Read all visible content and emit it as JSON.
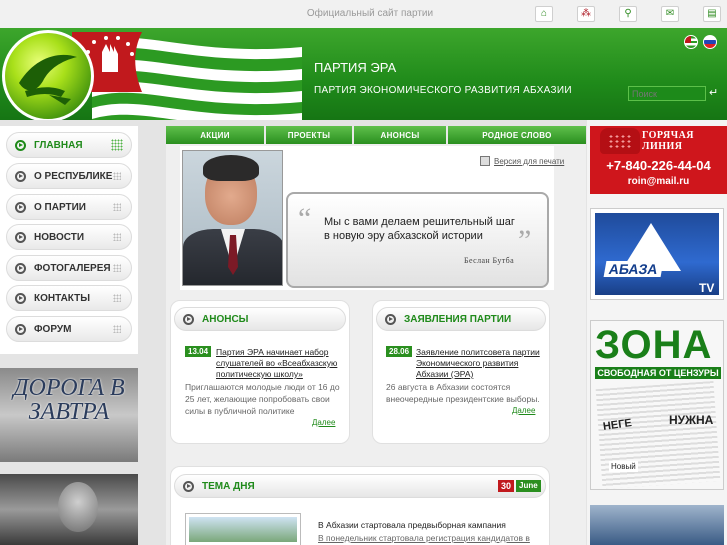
{
  "top": {
    "site_label": "Официальный сайт партии",
    "icons": [
      "home-icon",
      "sitemap-icon",
      "search-icon",
      "mail-icon",
      "print-icon"
    ]
  },
  "header": {
    "title": "ПАРТИЯ ЭРА",
    "subtitle": "ПАРТИЯ ЭКОНОМИЧЕСКОГО РАЗВИТИЯ АБХАЗИИ",
    "search_placeholder": "Поиск",
    "search_go": "↵",
    "languages": [
      "abkhazia-flag-icon",
      "russia-flag-icon"
    ],
    "colors": {
      "brand_green": "#1f8a1a",
      "accent_red": "#c1191d"
    }
  },
  "nav": {
    "items": [
      {
        "label": "ГЛАВНАЯ",
        "active": true
      },
      {
        "label": "О РЕСПУБЛИКЕ"
      },
      {
        "label": "О ПАРТИИ"
      },
      {
        "label": "НОВОСТИ"
      },
      {
        "label": "ФОТОГАЛЕРЕЯ"
      },
      {
        "label": "КОНТАКТЫ"
      },
      {
        "label": "ФОРУМ"
      }
    ]
  },
  "tabs": [
    "АКЦИИ",
    "ПРОЕКТЫ",
    "АНОНСЫ",
    "РОДНОЕ СЛОВО"
  ],
  "hero": {
    "print_label": "Версия для печати",
    "quote_line1": "Мы с вами делаем решительный шаг",
    "quote_line2": "в новую эру абхазской истории",
    "author": "Беслан Бутба"
  },
  "announcements": {
    "heading": "АНОНСЫ",
    "date": "13.04",
    "title": "Партия ЭРА начинает набор слушателей во «Всеабхазскую политическую школу»",
    "body": "Приглашаются молодые люди от 16 до 25 лет, желающие попробовать свои силы в публичной политике",
    "more": "Далее"
  },
  "statements": {
    "heading": "ЗАЯВЛЕНИЯ ПАРТИИ",
    "date": "28.06",
    "title": "Заявление политсовета партии Экономического развития Абхазии (ЭРА)",
    "body": "26 августа в Абхазии состоятся внеочередные президентские выборы.",
    "more": "Далее"
  },
  "topic": {
    "heading": "ТЕМА ДНЯ",
    "day": "30",
    "month": "June",
    "title": "В Абхазии стартовала предвыборная кампания",
    "body": "В понедельник стартовала регистрация кандидатов в"
  },
  "banners": {
    "road": "ДОРОГА В ЗАВТРА",
    "hotline_label": "ГОРЯЧАЯ ЛИНИЯ",
    "hotline_phone": "+7-840-226-44-04",
    "hotline_mail": "roin@mail.ru",
    "tv_name": "АБАЗА",
    "tv_suffix": "TV",
    "zona_title": "ЗОНА",
    "zona_sub": "СВОБОДНАЯ ОТ ЦЕНЗУРЫ",
    "zona_papers": [
      "НУЖНА",
      "НЕГЕ",
      "Новый"
    ]
  }
}
